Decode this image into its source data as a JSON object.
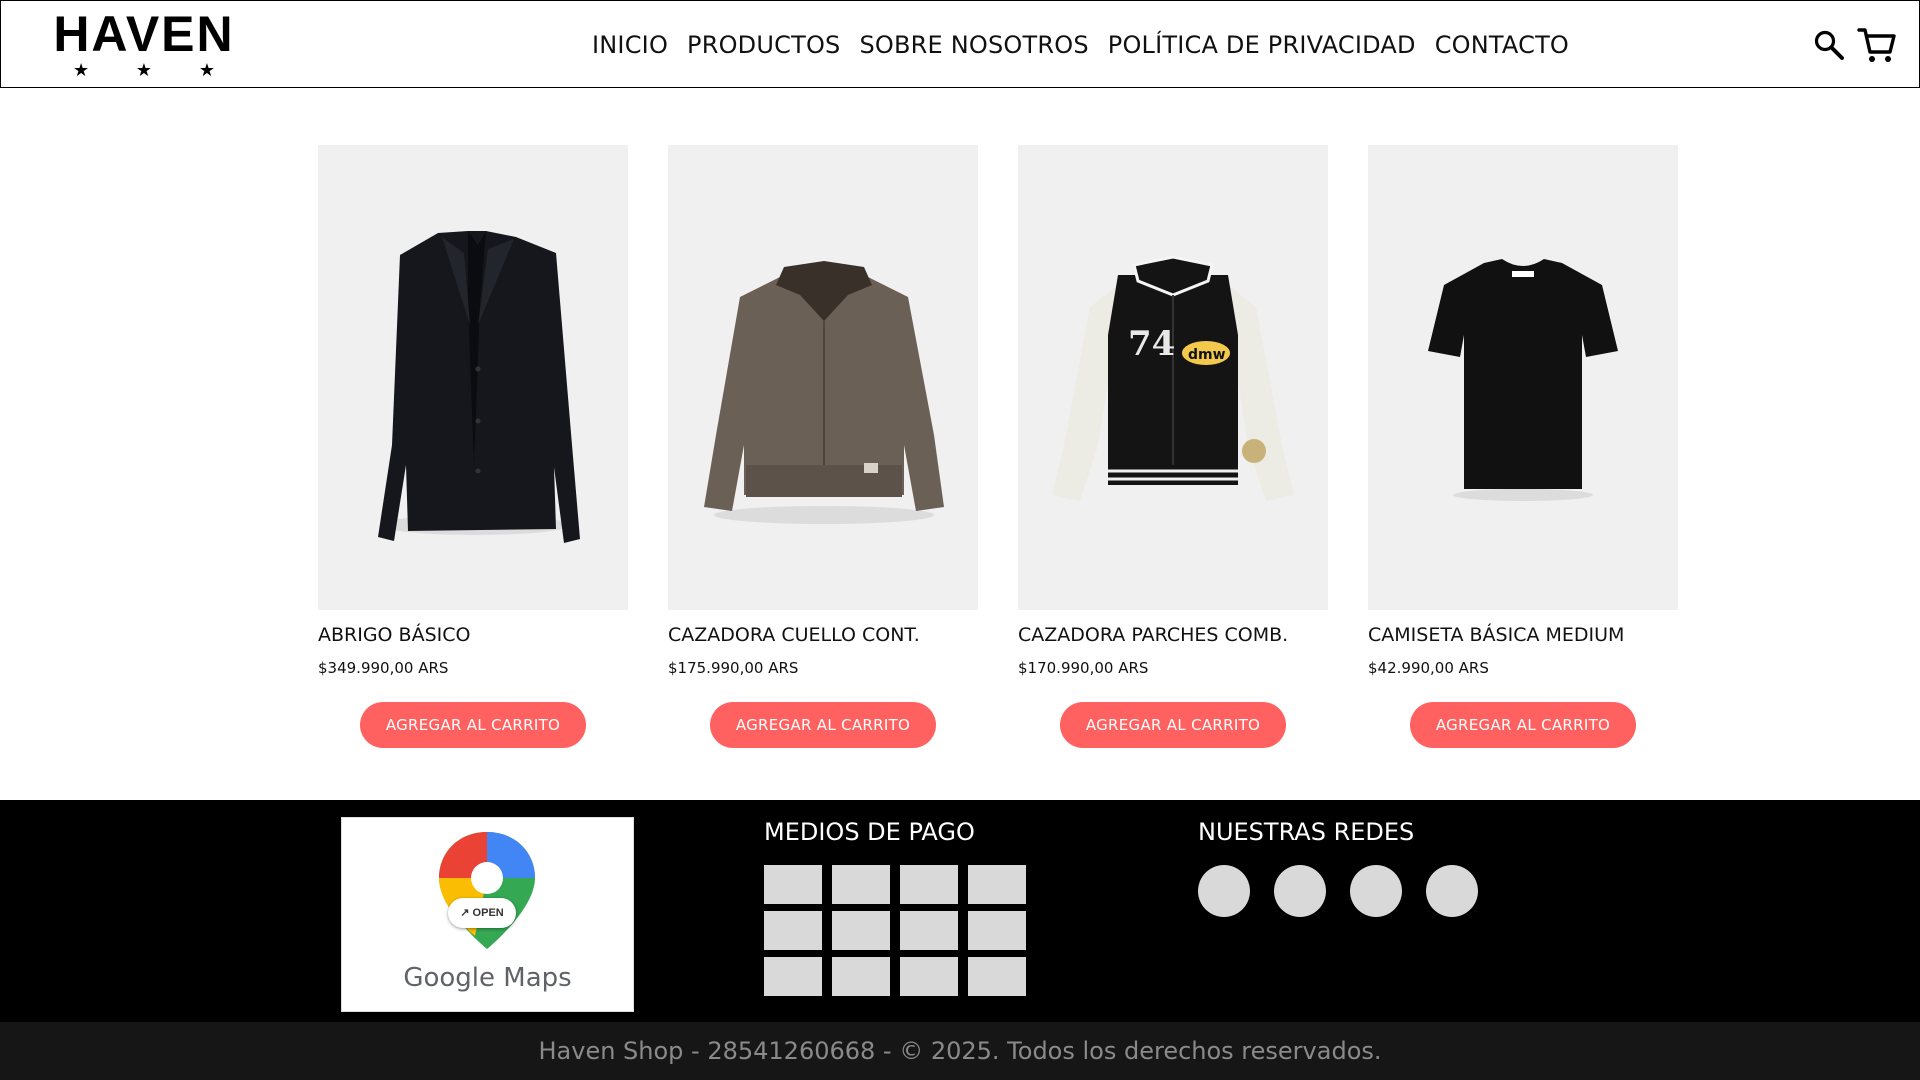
{
  "header": {
    "logo_text": "HAVEN",
    "logo_stars": [
      "★",
      "★",
      "★"
    ],
    "nav": [
      "INICIO",
      "PRODUCTOS",
      "SOBRE NOSOTROS",
      "POLÍTICA DE PRIVACIDAD",
      "CONTACTO"
    ],
    "icons": [
      "search-icon",
      "cart-icon"
    ]
  },
  "products": [
    {
      "name": "ABRIGO BÁSICO",
      "price": "$349.990,00 ARS",
      "button": "AGREGAR AL CARRITO",
      "image": "coat"
    },
    {
      "name": "CAZADORA CUELLO CONT.",
      "price": "$175.990,00 ARS",
      "button": "AGREGAR AL CARRITO",
      "image": "brown-jacket"
    },
    {
      "name": "CAZADORA PARCHES COMB.",
      "price": "$170.990,00 ARS",
      "button": "AGREGAR AL CARRITO",
      "image": "varsity-jacket"
    },
    {
      "name": "CAMISETA BÁSICA MEDIUM",
      "price": "$42.990,00 ARS",
      "button": "AGREGAR AL CARRITO",
      "image": "t-shirt"
    }
  ],
  "footer": {
    "map_badge": "OPEN",
    "map_label": "Google Maps",
    "payments_title": "MEDIOS DE PAGO",
    "payment_tile_count": 12,
    "social_title": "NUESTRAS REDES",
    "social_count": 4,
    "copyright": "Haven Shop - 28541260668 - © 2025. Todos los derechos reservados."
  },
  "colors": {
    "accent": "#ff6161",
    "footer_bg": "#000000",
    "bottom_bar_bg": "#161616",
    "tile": "#d9d9d9",
    "product_bg": "#f0f0f0"
  }
}
